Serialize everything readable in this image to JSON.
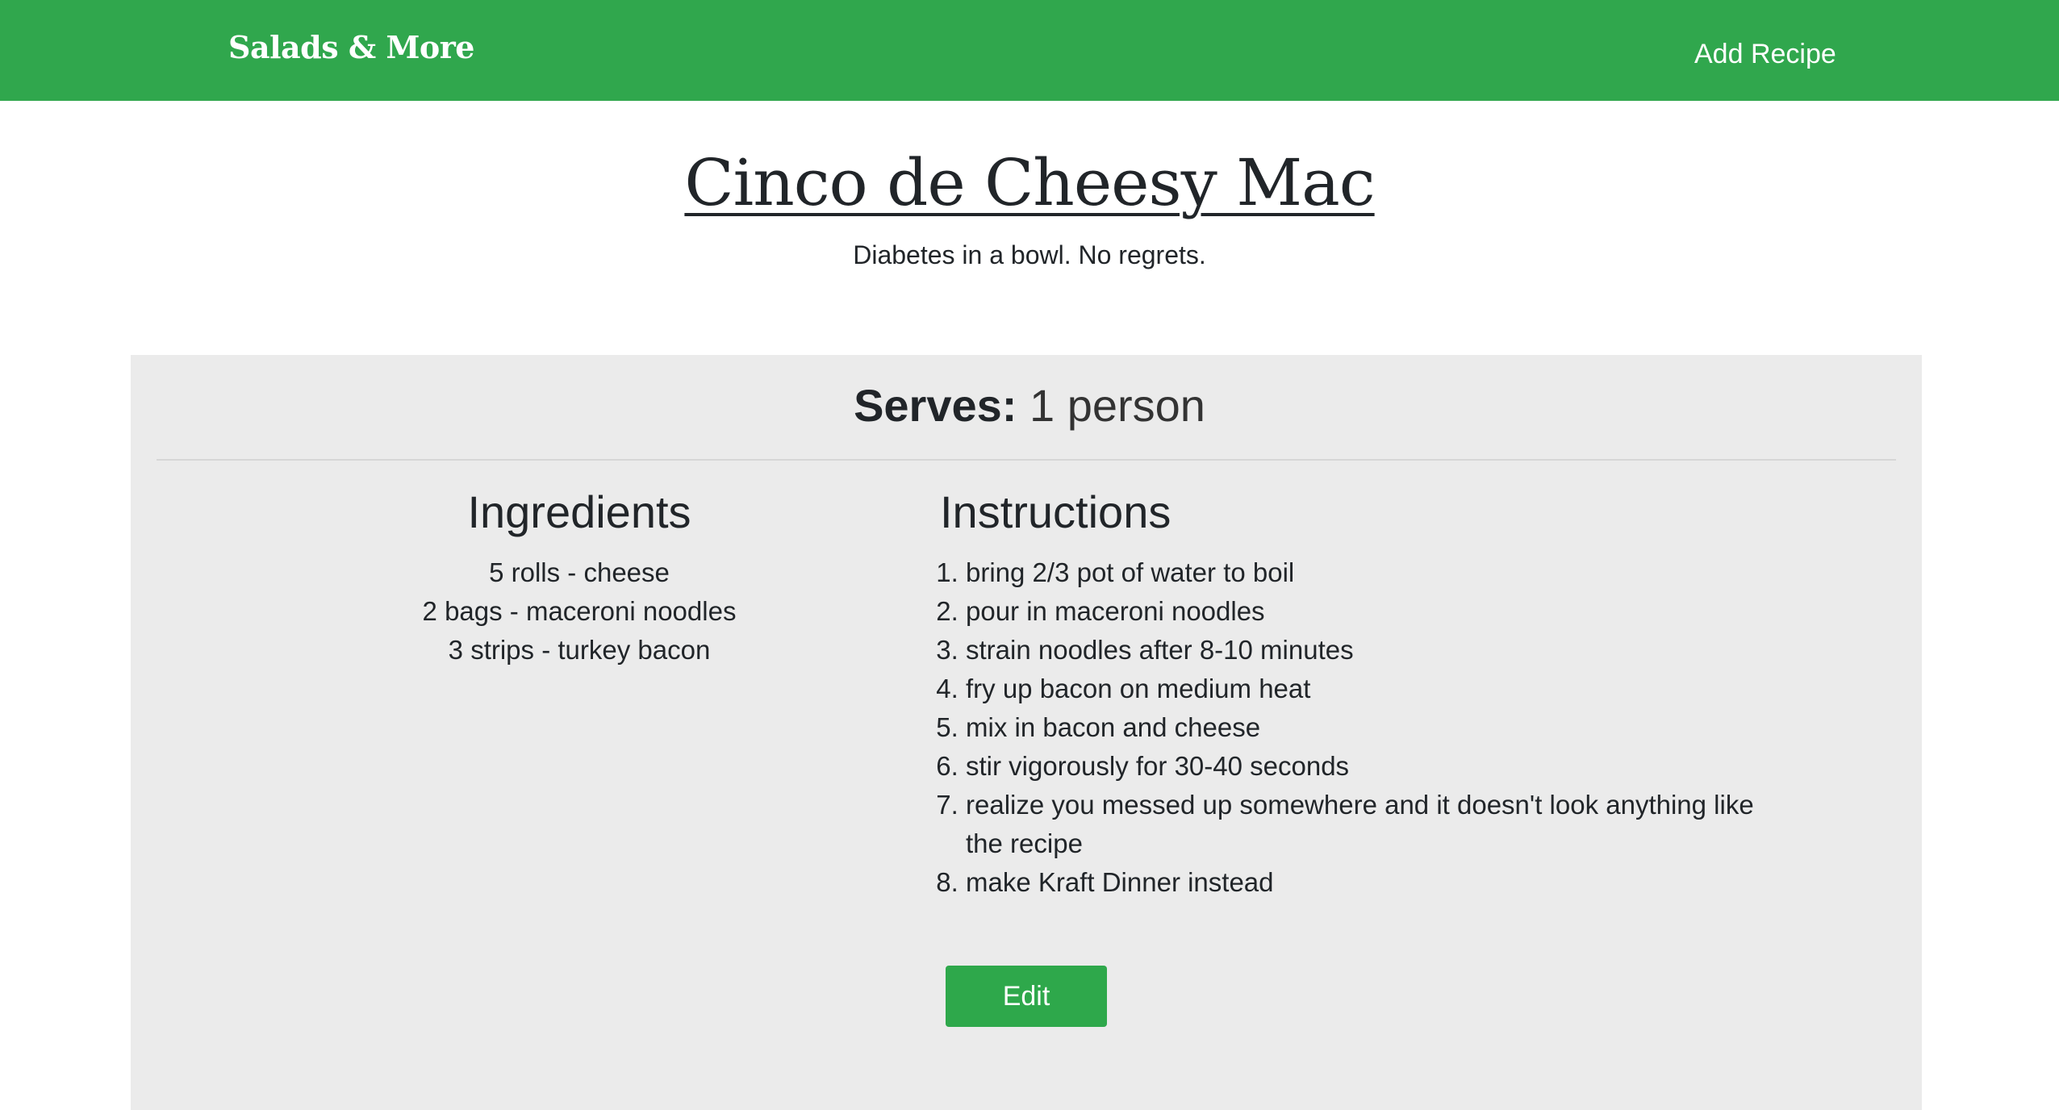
{
  "navbar": {
    "brand": "Salads & More",
    "add_recipe_label": "Add Recipe"
  },
  "recipe": {
    "title": "Cinco de Cheesy Mac",
    "description": "Diabetes in a bowl. No regrets.",
    "serves_label": "Serves:",
    "serves_value": "1 person",
    "ingredients_heading": "Ingredients",
    "ingredients": [
      "5 rolls - cheese",
      "2 bags - maceroni noodles",
      "3 strips - turkey bacon"
    ],
    "instructions_heading": "Instructions",
    "instructions": [
      "bring 2/3 pot of water to boil",
      "pour in maceroni noodles",
      "strain noodles after 8-10 minutes",
      "fry up bacon on medium heat",
      "mix in bacon and cheese",
      "stir vigorously for 30-40 seconds",
      "realize you messed up somewhere and it doesn't look anything like the recipe",
      "make Kraft Dinner instead"
    ],
    "edit_label": "Edit"
  },
  "colors": {
    "navbar": "#30a74d",
    "button": "#2ea84b",
    "card_background": "#ebebeb"
  }
}
